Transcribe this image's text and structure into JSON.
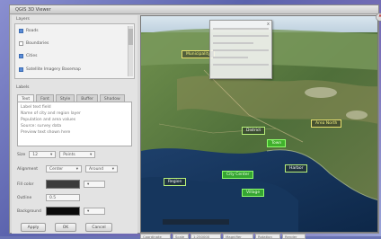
{
  "window": {
    "title": "QGIS 3D Viewer"
  },
  "panel": {
    "layers_label": "Layers",
    "layers": [
      {
        "label": "Roads",
        "checked": true
      },
      {
        "label": "Boundaries",
        "checked": false
      },
      {
        "label": "Cities",
        "checked": true
      },
      {
        "label": "Satellite Imagery Basemap",
        "checked": true
      }
    ],
    "labels_label": "Labels",
    "tabs": [
      "Text",
      "Font",
      "Style",
      "Buffer",
      "Shadow"
    ],
    "text_lines": [
      "Label text field",
      "Name of city and region layer",
      "Population and area values",
      "Source: survey data",
      "Preview text shown here"
    ],
    "size_label": "Size",
    "size_value": "12",
    "unit_value": "Points",
    "alignment_label": "Alignment",
    "alignment_value": "Center",
    "placement_value": "Around",
    "fill_label": "Fill color",
    "outline_label": "Outline",
    "outline_width": "0.5",
    "background_label": "Background",
    "fill_color": "#3b3b3b",
    "background_color": "#0b0b0b",
    "buttons": {
      "apply": "Apply",
      "ok": "OK",
      "cancel": "Cancel"
    }
  },
  "map": {
    "popup_close": "x",
    "labels": [
      {
        "text": "Region",
        "style": "plain"
      },
      {
        "text": "Municipality",
        "style": "yellow"
      },
      {
        "text": "Area North",
        "style": "yellow"
      },
      {
        "text": "Town",
        "style": "green"
      },
      {
        "text": "District",
        "style": "plain"
      },
      {
        "text": "City Center",
        "style": "green"
      },
      {
        "text": "Harbor",
        "style": "plain"
      },
      {
        "text": "Village",
        "style": "green"
      }
    ]
  },
  "status": [
    "Coordinate",
    "Scale",
    "1:250000",
    "Magnifier",
    "Rotation",
    "Render"
  ]
}
